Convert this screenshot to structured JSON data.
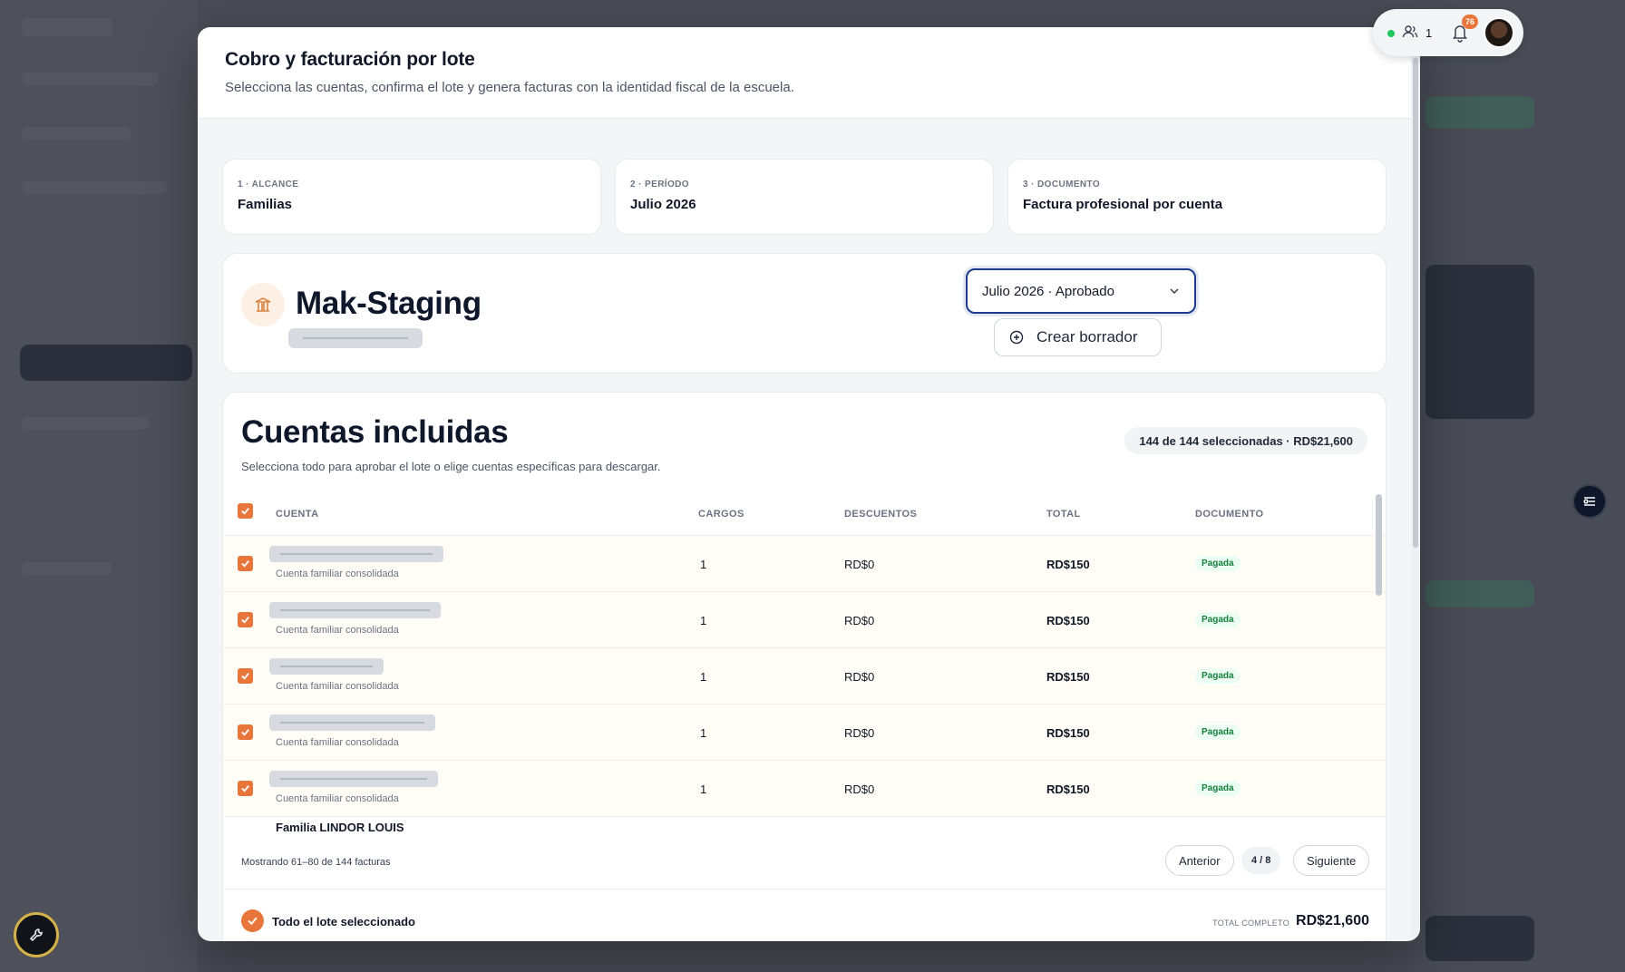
{
  "modal": {
    "title": "Cobro y facturación por lote",
    "subtitle": "Selecciona las cuentas, confirma el lote y genera facturas con la identidad fiscal de la escuela."
  },
  "steps": [
    {
      "kicker": "1 · ALCANCE",
      "value": "Familias"
    },
    {
      "kicker": "2 · PERÍODO",
      "value": "Julio 2026"
    },
    {
      "kicker": "3 · DOCUMENTO",
      "value": "Factura profesional por cuenta"
    }
  ],
  "school": {
    "name": "Mak-Staging",
    "period_select": "Julio 2026 · Aprobado",
    "draft_button": "Crear borrador"
  },
  "accounts": {
    "title": "Cuentas incluidas",
    "subtitle": "Selecciona todo para aprobar el lote o elige cuentas específicas para descargar.",
    "badge": "144 de 144 seleccionadas · RD$21,600",
    "columns": [
      "CUENTA",
      "CARGOS",
      "DESCUENTOS",
      "TOTAL",
      "DOCUMENTO"
    ],
    "rows": [
      {
        "subtitle": "Cuenta familiar consolidada",
        "cargos": "1",
        "descuentos": "RD$0",
        "total": "RD$150",
        "documento": "Pagada"
      },
      {
        "subtitle": "Cuenta familiar consolidada",
        "cargos": "1",
        "descuentos": "RD$0",
        "total": "RD$150",
        "documento": "Pagada"
      },
      {
        "subtitle": "Cuenta familiar consolidada",
        "cargos": "1",
        "descuentos": "RD$0",
        "total": "RD$150",
        "documento": "Pagada"
      },
      {
        "subtitle": "Cuenta familiar consolidada",
        "cargos": "1",
        "descuentos": "RD$0",
        "total": "RD$150",
        "documento": "Pagada"
      },
      {
        "subtitle": "Cuenta familiar consolidada",
        "cargos": "1",
        "descuentos": "RD$0",
        "total": "RD$150",
        "documento": "Pagada"
      }
    ],
    "partial_row_name": "Familia LINDOR LOUIS",
    "pagination": {
      "showing": "Mostrando 61–80 de 144 facturas",
      "prev": "Anterior",
      "page": "4 / 8",
      "next": "Siguiente"
    },
    "summary": {
      "label": "Todo el lote seleccionado",
      "total_label": "TOTAL COMPLETO",
      "total": "RD$21,600"
    }
  },
  "presence": {
    "online_count": "1",
    "notifications": "76"
  },
  "colors": {
    "accent": "#e8753a",
    "focus": "#1e3a8a",
    "success": "#15803d"
  }
}
